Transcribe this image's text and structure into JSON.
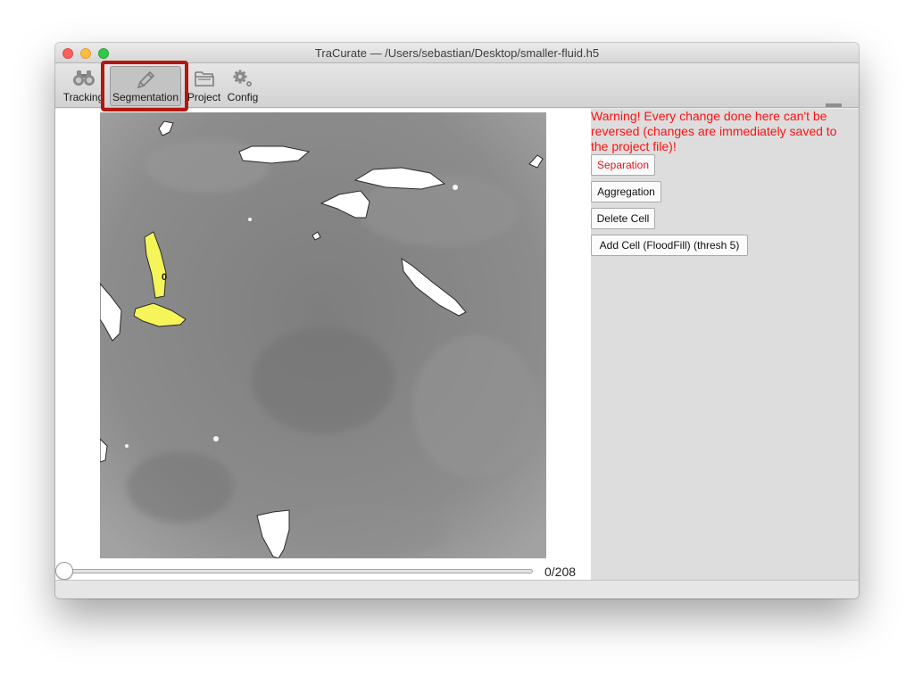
{
  "window": {
    "title": "TraCurate — /Users/sebastian/Desktop/smaller-fluid.h5"
  },
  "toolbar": {
    "items": [
      {
        "label": "Tracking",
        "icon": "binoculars-icon"
      },
      {
        "label": "Segmentation",
        "icon": "pencil-icon",
        "selected": true
      },
      {
        "label": "Project",
        "icon": "folder-icon"
      },
      {
        "label": "Config",
        "icon": "gear-icon"
      }
    ],
    "highlight_color": "#b3170f"
  },
  "viewer": {
    "selected_cell_label": "0",
    "selected_cell_color": "#f5f55a",
    "frame_counter": "0/208",
    "slider_value": 0,
    "slider_max": 208
  },
  "panel": {
    "warning": "Warning! Every change done here can't be reversed (changes are immediately saved to the project file)!",
    "warning_color": "#ff1111",
    "buttons": {
      "separation": "Separation",
      "aggregation": "Aggregation",
      "delete_cell": "Delete Cell",
      "add_cell": "Add Cell (FloodFill) (thresh 5)"
    }
  }
}
